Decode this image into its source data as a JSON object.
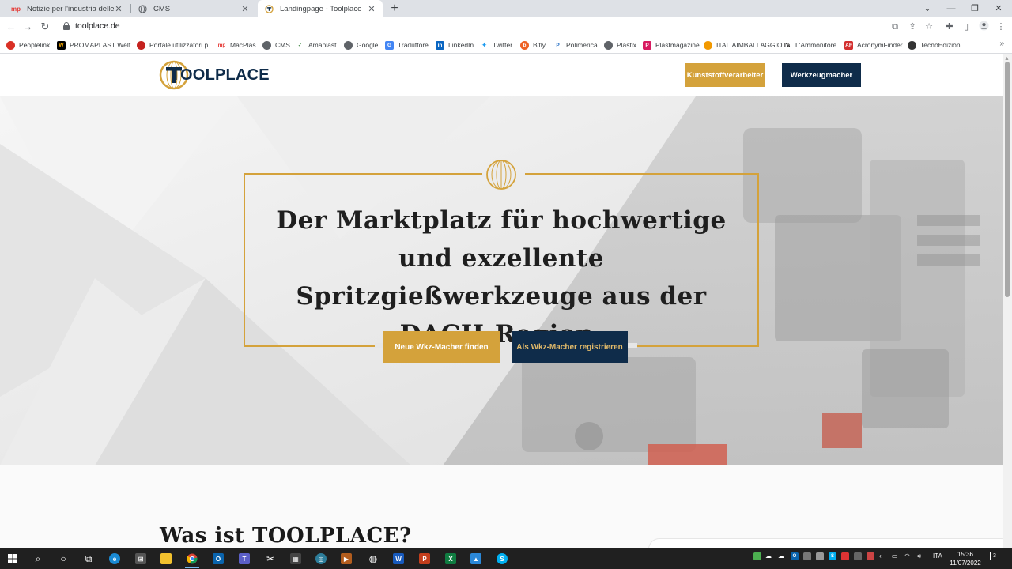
{
  "browser": {
    "tabs": [
      {
        "title": "Notizie per l'industria delle mate",
        "favicon": "mp-logo-icon"
      },
      {
        "title": "CMS",
        "favicon": "globe-icon"
      },
      {
        "title": "Landingpage - Toolplace",
        "favicon": "toolplace-logo-icon",
        "active": true
      }
    ],
    "url": "toolplace.de",
    "bookmarks": [
      {
        "label": "Peoplelink",
        "color": "#d93025"
      },
      {
        "label": "PROMAPLAST Welf...",
        "color": "#000000"
      },
      {
        "label": "Portale utilizzatori p...",
        "color": "#c5221f"
      },
      {
        "label": "MacPlas",
        "color": "#e53935"
      },
      {
        "label": "CMS",
        "color": "#5f6368"
      },
      {
        "label": "Amaplast",
        "color": "#2e7d32"
      },
      {
        "label": "Google",
        "color": "#5f6368"
      },
      {
        "label": "Traduttore",
        "color": "#4285f4"
      },
      {
        "label": "LinkedIn",
        "color": "#0a66c2"
      },
      {
        "label": "Twitter",
        "color": "#1d9bf0"
      },
      {
        "label": "Bitly",
        "color": "#ee6123"
      },
      {
        "label": "Polimerica",
        "color": "#1565c0"
      },
      {
        "label": "Plastix",
        "color": "#5f6368"
      },
      {
        "label": "Plastmagazine",
        "color": "#d81b60"
      },
      {
        "label": "ITALIAIMBALLAGGIO",
        "color": "#f29900"
      },
      {
        "label": "L'Ammonitore",
        "color": "#000000"
      },
      {
        "label": "AcronymFinder",
        "color": "#d32f2f"
      },
      {
        "label": "TecnoEdizioni",
        "color": "#333333"
      }
    ],
    "more_label": "»"
  },
  "site": {
    "logo_text": "TOOLPLACE",
    "header_buttons": {
      "primary": "Kunststoffverarbeiter",
      "secondary": "Werkzeugmacher"
    },
    "hero": {
      "headline": "Der Marktplatz für hochwertige und exzellente Spritzgießwerkzeuge aus der DACH-Region.",
      "cta_primary": "Neue Wkz-Macher finden",
      "cta_secondary": "Als Wkz-Macher registrieren"
    },
    "section_title": "Was ist TOOLPLACE?"
  },
  "colors": {
    "gold": "#d4a23b",
    "navy": "#0f2c4a"
  },
  "taskbar": {
    "language": "ITA",
    "time": "15:36",
    "date": "11/07/2022",
    "notification_count": "3"
  }
}
